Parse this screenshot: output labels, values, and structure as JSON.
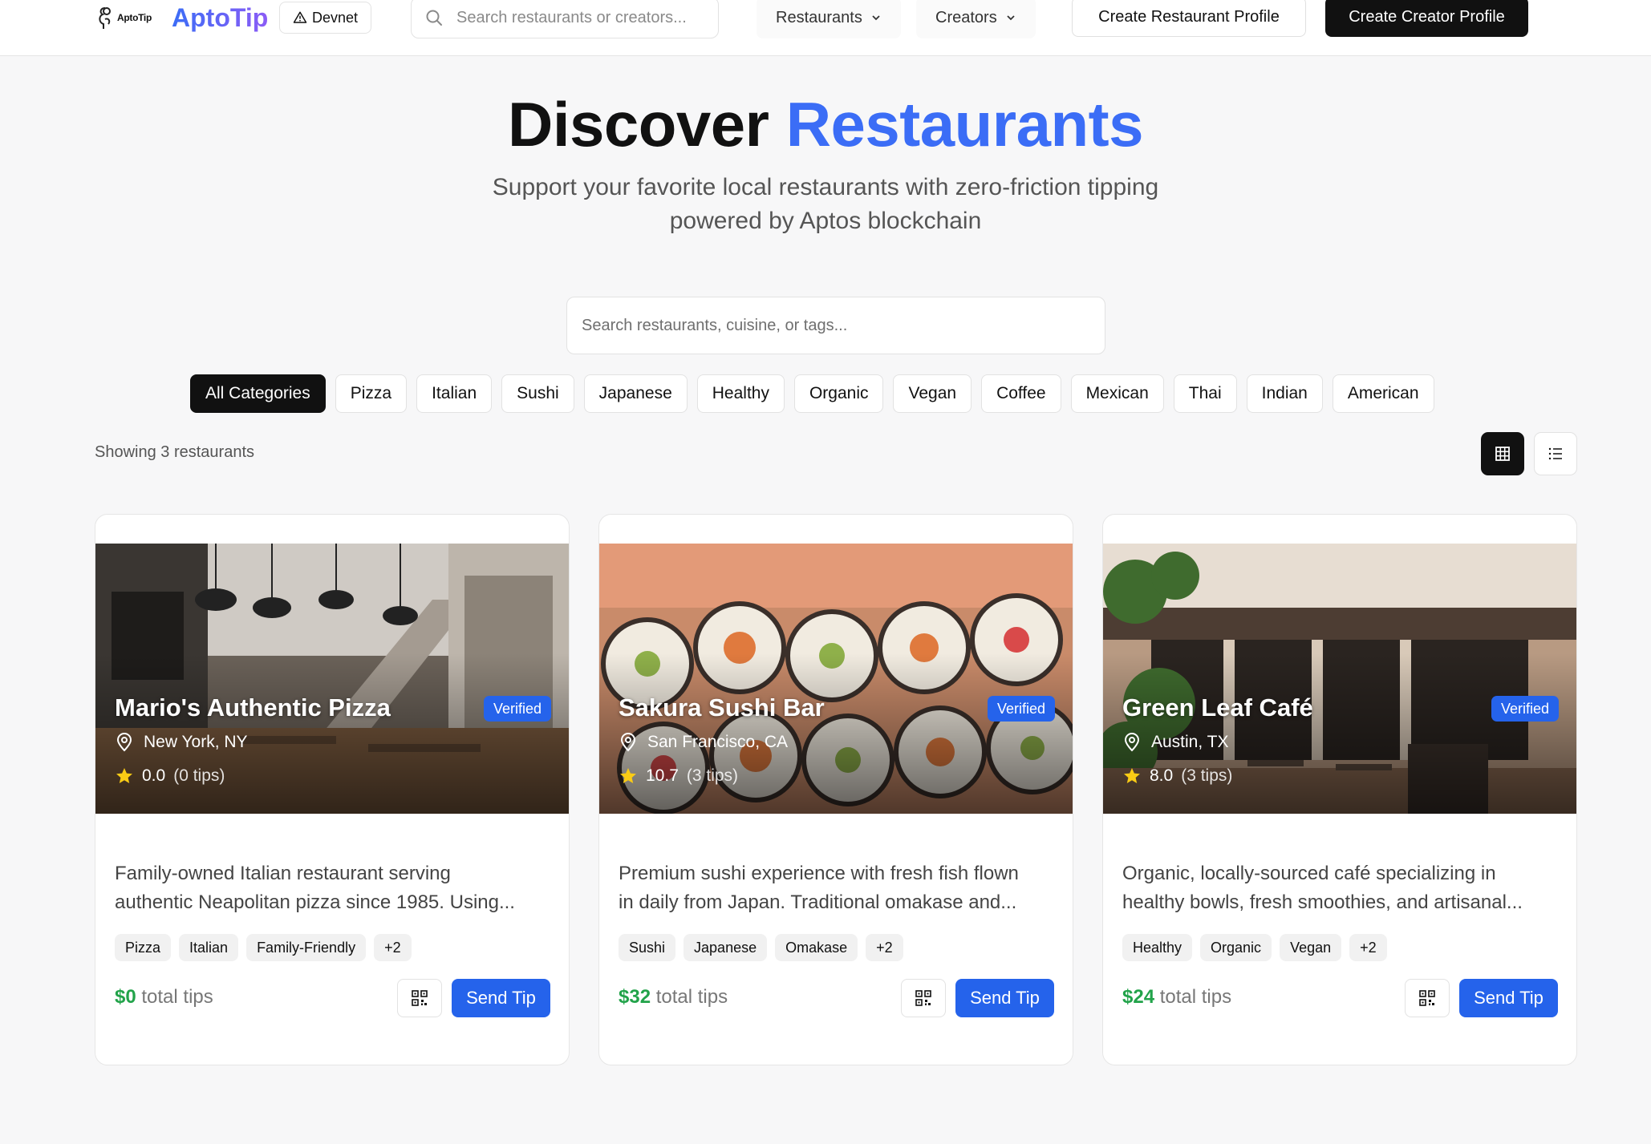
{
  "header": {
    "logo_text": "AptoTip",
    "brand": "AptoTip",
    "network_badge": "Devnet",
    "search_placeholder": "Search restaurants or creators...",
    "nav": {
      "restaurants": "Restaurants",
      "creators": "Creators"
    },
    "create_restaurant": "Create Restaurant Profile",
    "create_creator": "Create Creator Profile"
  },
  "hero": {
    "title_main": "Discover",
    "title_accent": "Restaurants",
    "subtitle_line1": "Support your favorite local restaurants with zero-friction tipping",
    "subtitle_line2": "powered by Aptos blockchain"
  },
  "search": {
    "placeholder": "Search restaurants, cuisine, or tags..."
  },
  "categories": [
    "All Categories",
    "Pizza",
    "Italian",
    "Sushi",
    "Japanese",
    "Healthy",
    "Organic",
    "Vegan",
    "Coffee",
    "Mexican",
    "Thai",
    "Indian",
    "American"
  ],
  "results": {
    "count_text": "Showing 3 restaurants"
  },
  "restaurants": [
    {
      "name": "Mario's Authentic Pizza",
      "verified": "Verified",
      "location": "New York, NY",
      "rating": "0.0",
      "tips_count": "(0 tips)",
      "desc_line1": "Family-owned Italian restaurant serving",
      "desc_line2": "authentic Neapolitan pizza since 1985. Using...",
      "tags": [
        "Pizza",
        "Italian",
        "Family-Friendly",
        "+2"
      ],
      "total_amount": "$0",
      "total_label": "total tips",
      "tip_button": "Send Tip"
    },
    {
      "name": "Sakura Sushi Bar",
      "verified": "Verified",
      "location": "San Francisco, CA",
      "rating": "10.7",
      "tips_count": "(3 tips)",
      "desc_line1": "Premium sushi experience with fresh fish flown",
      "desc_line2": "in daily from Japan. Traditional omakase and...",
      "tags": [
        "Sushi",
        "Japanese",
        "Omakase",
        "+2"
      ],
      "total_amount": "$32",
      "total_label": "total tips",
      "tip_button": "Send Tip"
    },
    {
      "name": "Green Leaf Café",
      "verified": "Verified",
      "location": "Austin, TX",
      "rating": "8.0",
      "tips_count": "(3 tips)",
      "desc_line1": "Organic, locally-sourced café specializing in",
      "desc_line2": "healthy bowls, fresh smoothies, and artisanal...",
      "tags": [
        "Healthy",
        "Organic",
        "Vegan",
        "+2"
      ],
      "total_amount": "$24",
      "total_label": "total tips",
      "tip_button": "Send Tip"
    }
  ],
  "colors": {
    "accent_blue": "#3b6df6",
    "button_blue": "#2563eb",
    "money_green": "#22a34a",
    "dark": "#111111"
  },
  "icons": [
    "search-icon",
    "warning-triangle-icon",
    "chevron-down-icon",
    "grid-view-icon",
    "list-view-icon",
    "location-pin-icon",
    "star-icon",
    "qr-code-icon"
  ]
}
